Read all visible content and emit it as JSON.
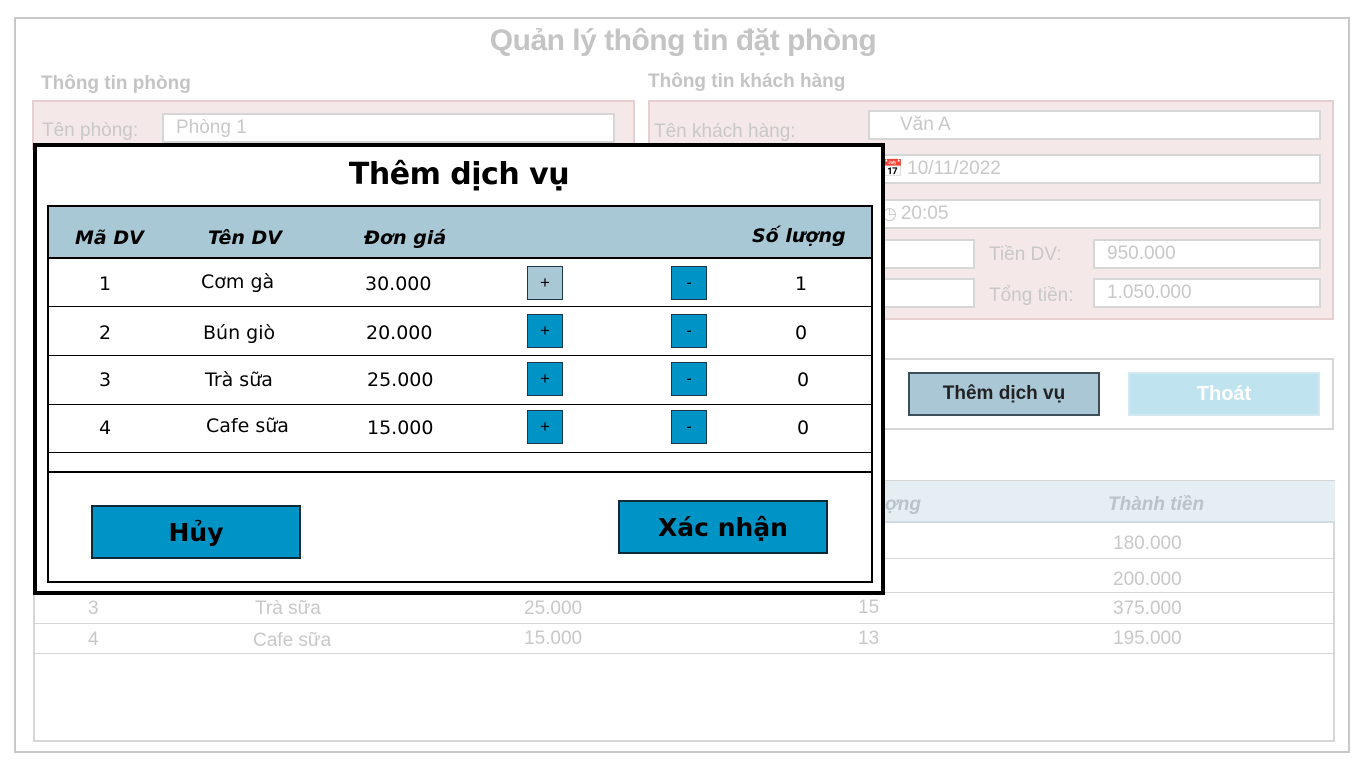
{
  "background": {
    "title": "Quản lý thông tin đặt phòng",
    "room_section": {
      "heading": "Thông tin phòng",
      "room_name_label": "Tên phòng:",
      "room_name_value": "Phòng 1"
    },
    "customer_section": {
      "heading": "Thông tin khách hàng",
      "customer_name_label": "Tên khách hàng:",
      "customer_name_value": "Văn A",
      "date_value": "10/11/2022",
      "time_value": "20:05",
      "service_fee_label": "Tiền DV:",
      "service_fee_value": "950.000",
      "total_label": "Tổng tiền:",
      "total_value": "1.050.000"
    },
    "buttons": {
      "add_service": "Thêm dịch vụ",
      "exit": "Thoát"
    },
    "table": {
      "headers": [
        "ợng",
        "Thành tiền"
      ],
      "rows": [
        {
          "total": "180.000"
        },
        {
          "total": "200.000"
        },
        {
          "id": "3",
          "name": "Trà sữa",
          "price": "25.000",
          "qty": "15",
          "total": "375.000"
        },
        {
          "id": "4",
          "name": "Cafe sữa",
          "price": "15.000",
          "qty": "13",
          "total": "195.000"
        }
      ]
    }
  },
  "modal": {
    "title": "Thêm dịch vụ",
    "headers": {
      "id": "Mã DV",
      "name": "Tên DV",
      "price": "Đơn giá",
      "qty": "Số lượng"
    },
    "plus_label": "+",
    "minus_label": "-",
    "rows": [
      {
        "id": "1",
        "name": "Cơm gà",
        "price": "30.000",
        "qty": "1"
      },
      {
        "id": "2",
        "name": "Bún giò",
        "price": "20.000",
        "qty": "0"
      },
      {
        "id": "3",
        "name": "Trà sữa",
        "price": "25.000",
        "qty": "0"
      },
      {
        "id": "4",
        "name": "Cafe sữa",
        "price": "15.000",
        "qty": "0"
      }
    ],
    "cancel_label": "Hủy",
    "confirm_label": "Xác nhận"
  },
  "colors": {
    "accent": "#0094c6",
    "header_bg": "#a9c8d6",
    "panel_bg": "#f5e8e8",
    "light_button": "#bfe4ef"
  },
  "icons": {
    "date": "calendar-icon",
    "time": "clock-icon"
  }
}
